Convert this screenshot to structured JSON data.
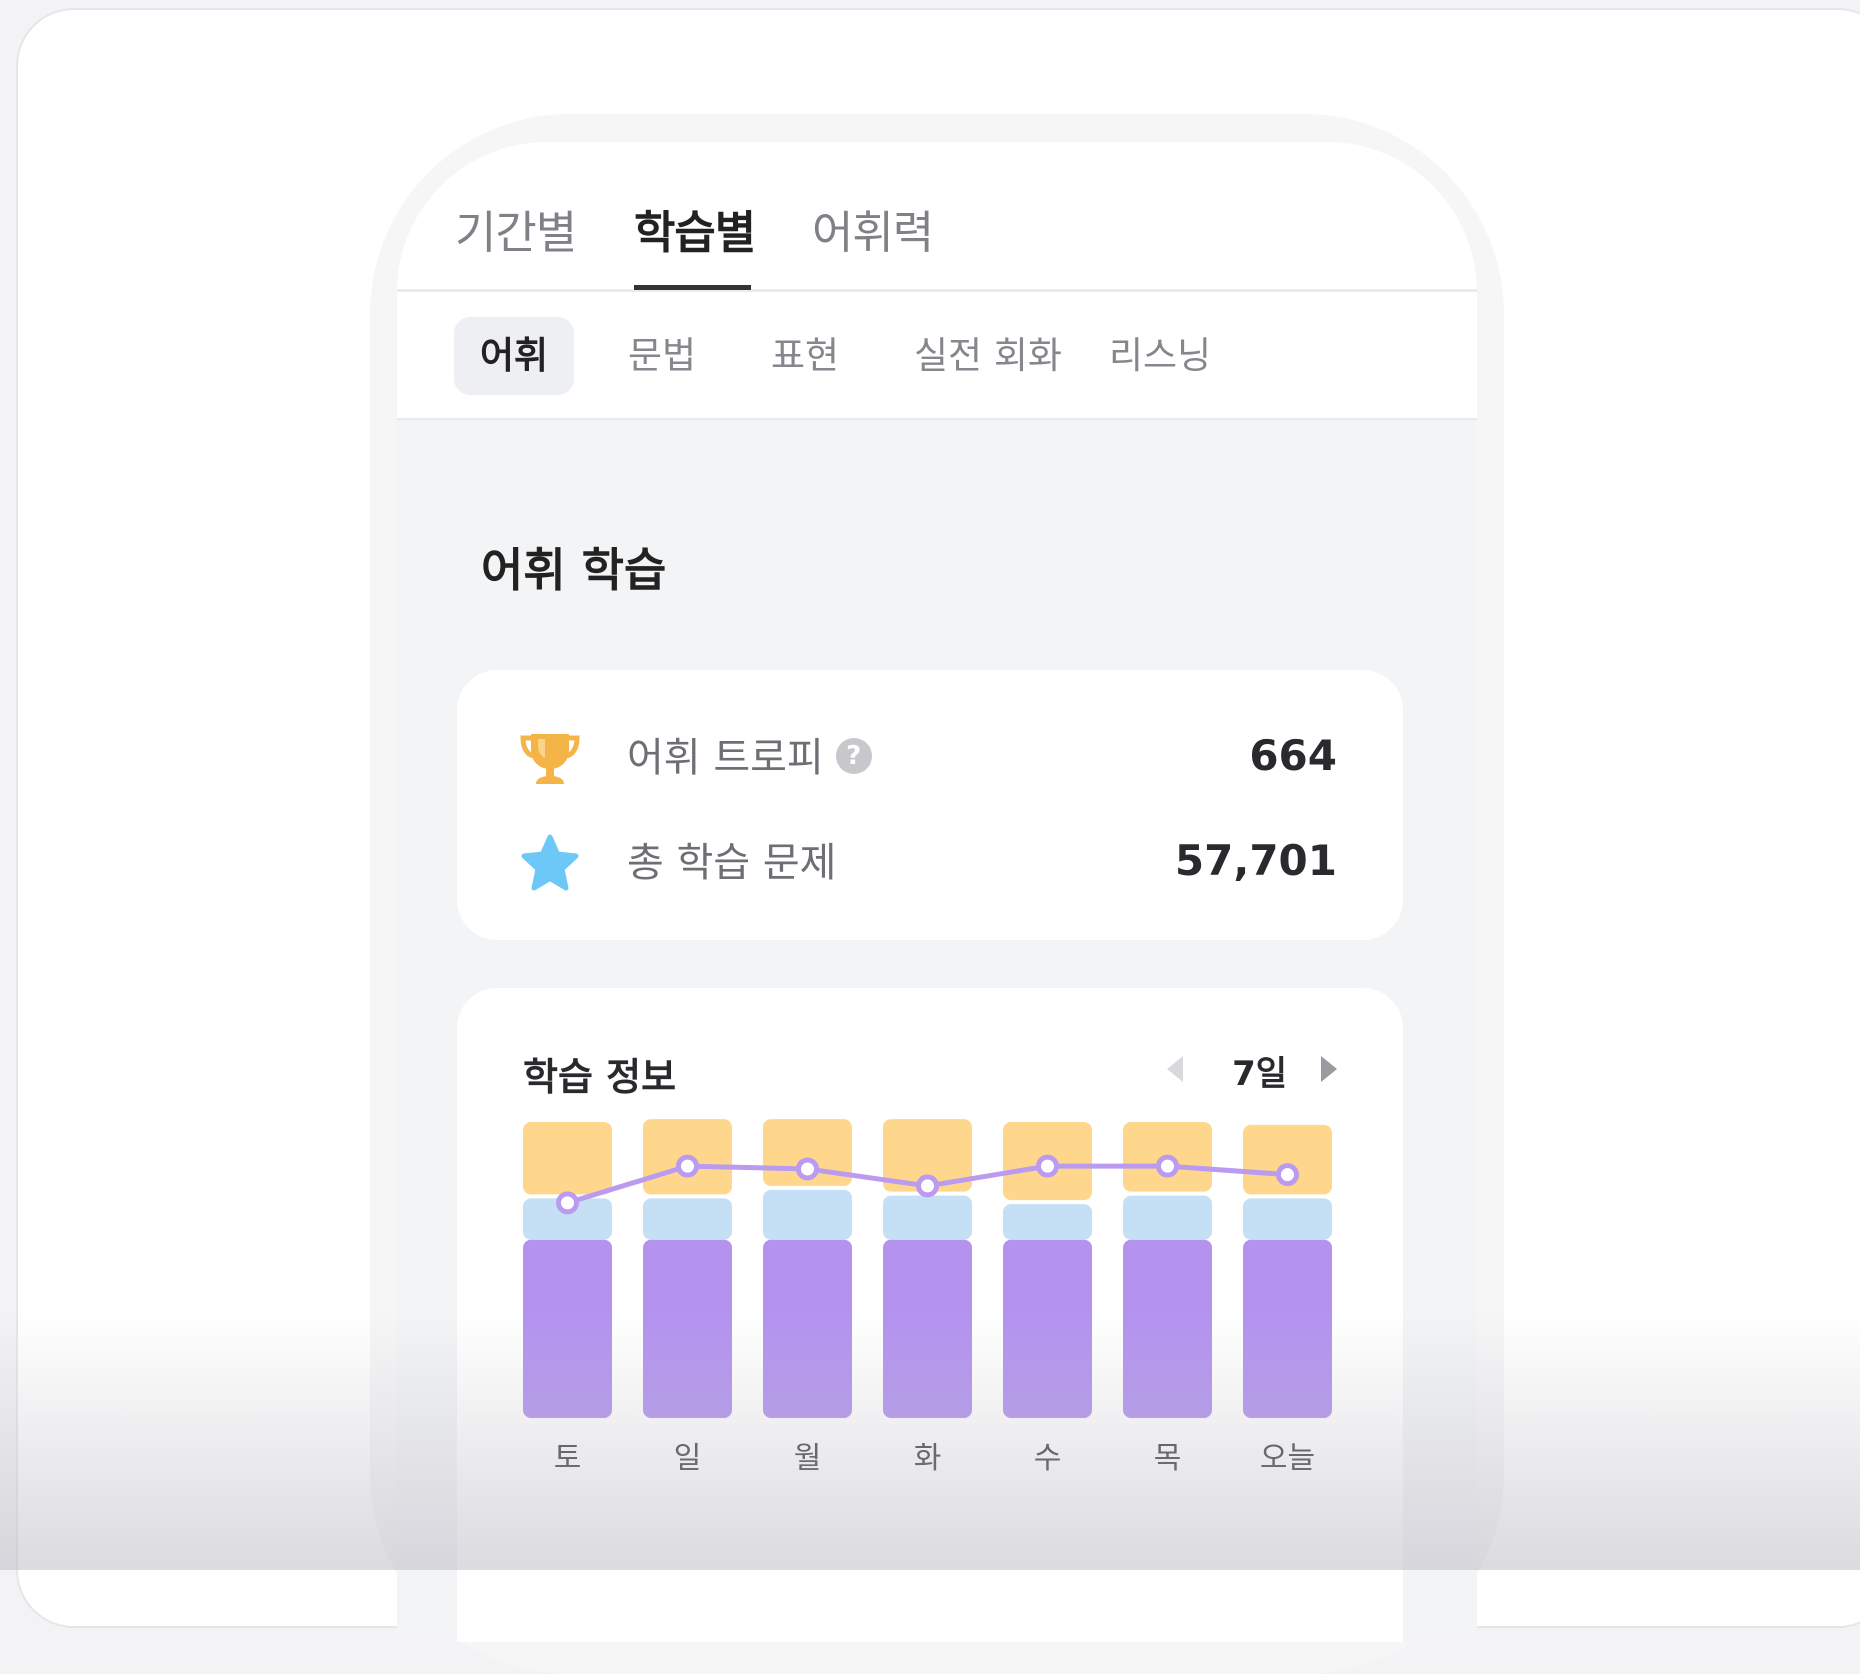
{
  "main_tabs": [
    {
      "label": "기간별",
      "active": false
    },
    {
      "label": "학습별",
      "active": true
    },
    {
      "label": "어휘력",
      "active": false
    }
  ],
  "sub_tabs": [
    {
      "label": "어휘",
      "active": true
    },
    {
      "label": "문법",
      "active": false
    },
    {
      "label": "표현",
      "active": false
    },
    {
      "label": "실전 회화",
      "active": false
    },
    {
      "label": "리스닝",
      "active": false
    }
  ],
  "section": {
    "title": "어휘 학습"
  },
  "stats": {
    "trophy": {
      "label": "어휘 트로피",
      "help": "?",
      "value": "664",
      "icon": "trophy-icon"
    },
    "total": {
      "label": "총 학습 문제",
      "value": "57,701",
      "icon": "star-icon"
    }
  },
  "study_info": {
    "title": "학습 정보",
    "period_label": "7일"
  },
  "colors": {
    "orange_segment": "#fed68c",
    "blue_segment": "#c5e0f5",
    "purple_segment": "#b393ef",
    "line": "#bb9bf0",
    "trophy": "#f5b448",
    "star": "#6ec8f7"
  },
  "chart_data": {
    "type": "bar",
    "stacked": true,
    "categories": [
      "토",
      "일",
      "월",
      "화",
      "수",
      "목",
      "오늘"
    ],
    "series": [
      {
        "values": [
          0.63,
          0.63,
          0.63,
          0.63,
          0.63,
          0.63,
          0.63
        ],
        "color": "#b393ef"
      },
      {
        "values": [
          0.16,
          0.16,
          0.19,
          0.17,
          0.14,
          0.17,
          0.16
        ],
        "color": "#c5e0f5"
      },
      {
        "values": [
          0.27,
          0.28,
          0.25,
          0.27,
          0.29,
          0.26,
          0.26
        ],
        "color": "#fed68c"
      }
    ],
    "line": {
      "values": [
        0.76,
        0.89,
        0.88,
        0.82,
        0.89,
        0.89,
        0.86
      ],
      "color": "#bb9bf0"
    },
    "ylim": [
      0,
      1.06
    ],
    "grid": false,
    "legend": "none"
  }
}
